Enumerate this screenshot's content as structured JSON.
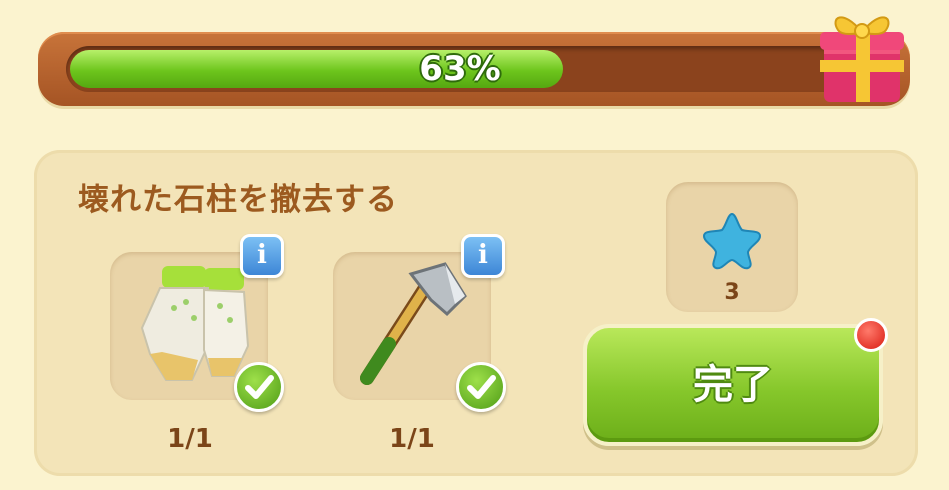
{
  "progress": {
    "percent_label": "63%",
    "fraction": 0.63
  },
  "gift": {
    "icon": "gift-box-icon"
  },
  "task": {
    "title": "壊れた石柱を撤去する",
    "requirements": [
      {
        "icon": "gloves-icon",
        "count": "1/1",
        "completed": true
      },
      {
        "icon": "axe-icon",
        "count": "1/1",
        "completed": true
      }
    ],
    "reward": {
      "icon": "blue-star-icon",
      "count": "3"
    },
    "complete_label": "完了"
  },
  "colors": {
    "progress_fill": "#6dc51c",
    "title_brown": "#9c5a1f",
    "button_green": "#86c72b",
    "notification_red": "#d91b12"
  }
}
